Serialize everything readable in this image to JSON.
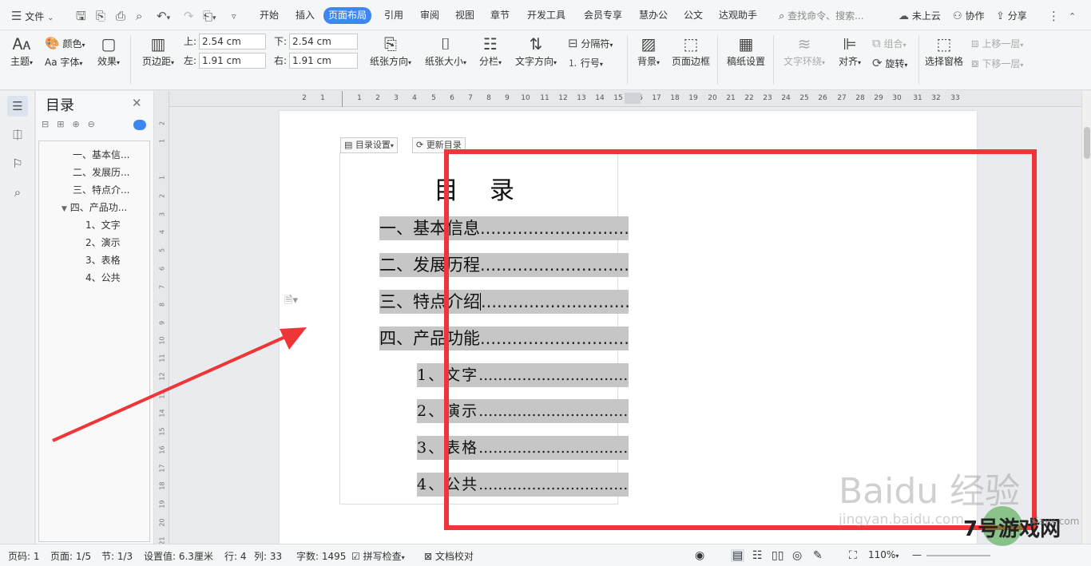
{
  "topbar": {
    "menu_label": "文件",
    "tabs": [
      "开始",
      "插入",
      "页面布局",
      "引用",
      "审阅",
      "视图",
      "章节",
      "开发工具",
      "会员专享",
      "慧办公",
      "公文",
      "达观助手"
    ],
    "active_tab": "页面布局",
    "search_placeholder": "查找命令、搜索...",
    "cloud_label": "未上云",
    "collab_label": "协作",
    "share_label": "分享"
  },
  "ribbon": {
    "theme": "主题",
    "color": "颜色",
    "font": "字体",
    "font_prefix": "Aa",
    "effect": "效果",
    "margins": "页边距",
    "margin_top_label": "上:",
    "margin_top": "2.54 cm",
    "margin_bottom_label": "下:",
    "margin_bottom": "2.54 cm",
    "margin_left_label": "左:",
    "margin_left": "1.91 cm",
    "margin_right_label": "右:",
    "margin_right": "1.91 cm",
    "orientation": "纸张方向",
    "size": "纸张大小",
    "columns": "分栏",
    "text_direction": "文字方向",
    "breaks": "分隔符",
    "line_numbers": "行号",
    "background": "背景",
    "page_border": "页面边框",
    "manuscript": "稿纸设置",
    "wrap_text": "文字环绕",
    "align": "对齐",
    "rotate": "旋转",
    "group": "组合",
    "selection_pane": "选择窗格",
    "bring_forward": "上移一层",
    "send_backward": "下移一层"
  },
  "toc_panel": {
    "title": "目录",
    "items": [
      {
        "label": "一、基本信..."
      },
      {
        "label": "二、发展历..."
      },
      {
        "label": "三、特点介..."
      },
      {
        "label": "四、产品功..."
      },
      {
        "label": "1、文字"
      },
      {
        "label": "2、演示"
      },
      {
        "label": "3、表格"
      },
      {
        "label": "4、公共"
      }
    ]
  },
  "hruler_ticks": [
    "2",
    "1",
    "1",
    "2",
    "3",
    "4",
    "5",
    "6",
    "7",
    "8",
    "9",
    "10",
    "11",
    "12",
    "13",
    "14",
    "15",
    "16",
    "17",
    "18",
    "19",
    "20",
    "21",
    "22",
    "23",
    "24",
    "25",
    "26",
    "27",
    "28",
    "29",
    "30",
    "31",
    "32",
    "33"
  ],
  "vruler_ticks": [
    "2",
    "1",
    "1",
    "2",
    "3",
    "4",
    "5",
    "6",
    "7",
    "8",
    "9",
    "10",
    "11",
    "12",
    "13",
    "14",
    "15",
    "16",
    "17",
    "18",
    "19",
    "20",
    "21"
  ],
  "document": {
    "toc_settings": "目录设置",
    "toc_update": "更新目录",
    "heading": "目　录",
    "entries": [
      {
        "text": "一、基本信息",
        "dots": "......................................."
      },
      {
        "text": "二、发展历程",
        "dots": "......................................."
      },
      {
        "text": "三、特点介绍",
        "dots": "......................................."
      },
      {
        "text": "四、产品功能",
        "dots": "......................................."
      },
      {
        "text": "1、文字",
        "dots": "......................................."
      },
      {
        "text": "2、演示",
        "dots": "......................................."
      },
      {
        "text": "3、表格",
        "dots": "......................................."
      },
      {
        "text": "4、公共",
        "dots": "......................................."
      }
    ]
  },
  "status": {
    "page_num": "页码: 1",
    "pages": "页面: 1/5",
    "section": "节: 1/3",
    "setting": "设置值: 6.3厘米",
    "row": "行: 4",
    "col": "列: 33",
    "words": "字数: 1495",
    "spell": "拼写检查",
    "proof": "文档校对",
    "zoom": "110%"
  },
  "watermark": {
    "baidu": "Baidu 经验",
    "jingyan": "jingyan.baidu.com",
    "site": "7号游戏网",
    "site_url": "xiayx.com"
  },
  "colors": {
    "accent": "#3f87f0",
    "highlight": "#ee3537",
    "toc_shade": "#c6c6c6"
  }
}
